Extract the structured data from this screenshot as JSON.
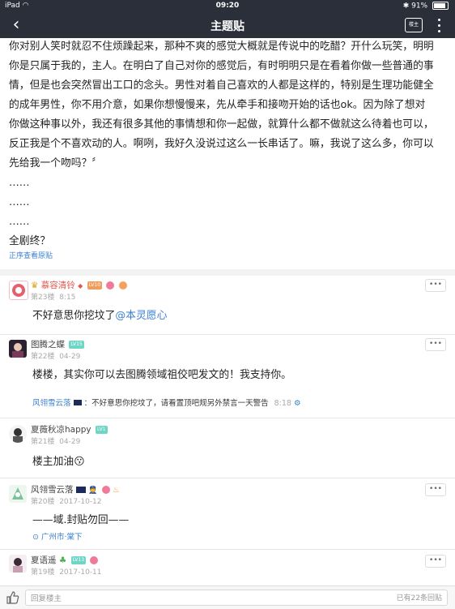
{
  "status": {
    "device": "iPad",
    "time": "09:20",
    "battery": "91%"
  },
  "nav": {
    "title": "主题贴",
    "owner_label": "楼主"
  },
  "article": {
    "paragraphs": [
      "你对别人笑时就忍不住烦躁起来，那种不爽的感觉大概就是传说中的吃醋？开什么玩笑，明明",
      "你是只属于我的，主人。在明白了自己对你的感觉后，有时明明只是在看着你做一些普通的事",
      "情，但是也会突然冒出工口的念头。男性对着自己喜欢的人都是这样的，特别是生理功能健全",
      "的成年男性，你不用介意，如果你想慢慢来，先从牵手和接吻开始的话也ok。因为除了想对",
      "你做这种事以外，我还有很多其他的事情想和你一起做，就算什么都不做就这么待着也可以，",
      "反正我是个不喜欢动的人。啊咧，我好久没说过这么一长串话了。嘛，我说了这么多，你可以",
      "先给我一个吻吗？〞",
      "……",
      "……",
      "……",
      "全剧终？"
    ],
    "view_original": "正序查看原贴"
  },
  "replies": [
    {
      "name": "慕容清铃",
      "level": "LV10",
      "floor": "第23楼",
      "time": "8:15",
      "content": "不好意思你挖坟了",
      "mention": "@本灵愿心"
    },
    {
      "name": "图腾之蝶",
      "level": "LV15",
      "floor": "第22楼",
      "time": "04-29",
      "content": "楼楼，其实你可以去图腾领域祖佼吧发文的！我支持你。",
      "sub": {
        "who": "风翎雪云落",
        "text": "：不好意思你挖坟了，请看置顶吧规另外禁言一天警告",
        "time": "8:18"
      }
    },
    {
      "name": "夏薇秋凉happy",
      "level": "LV1",
      "floor": "第21楼",
      "time": "04-29",
      "content": "楼主加油",
      "emoji": "😗"
    },
    {
      "name": "风翎雪云落",
      "floor": "第20楼",
      "time": "2017-10-12",
      "content": "——域.封贴勿回——",
      "location": "广州市·棠下"
    },
    {
      "name": "夏语遥",
      "level": "LV13",
      "floor": "第19楼",
      "time": "2017-10-11"
    }
  ],
  "more_label": "•••",
  "bottom": {
    "placeholder": "回复楼主",
    "count": "已有22条回贴"
  },
  "colors": {
    "nav_bg": "#2b2f3a",
    "link": "#3a80d0",
    "vip_name": "#e2564b",
    "level_badge": "#6fd5c6"
  }
}
